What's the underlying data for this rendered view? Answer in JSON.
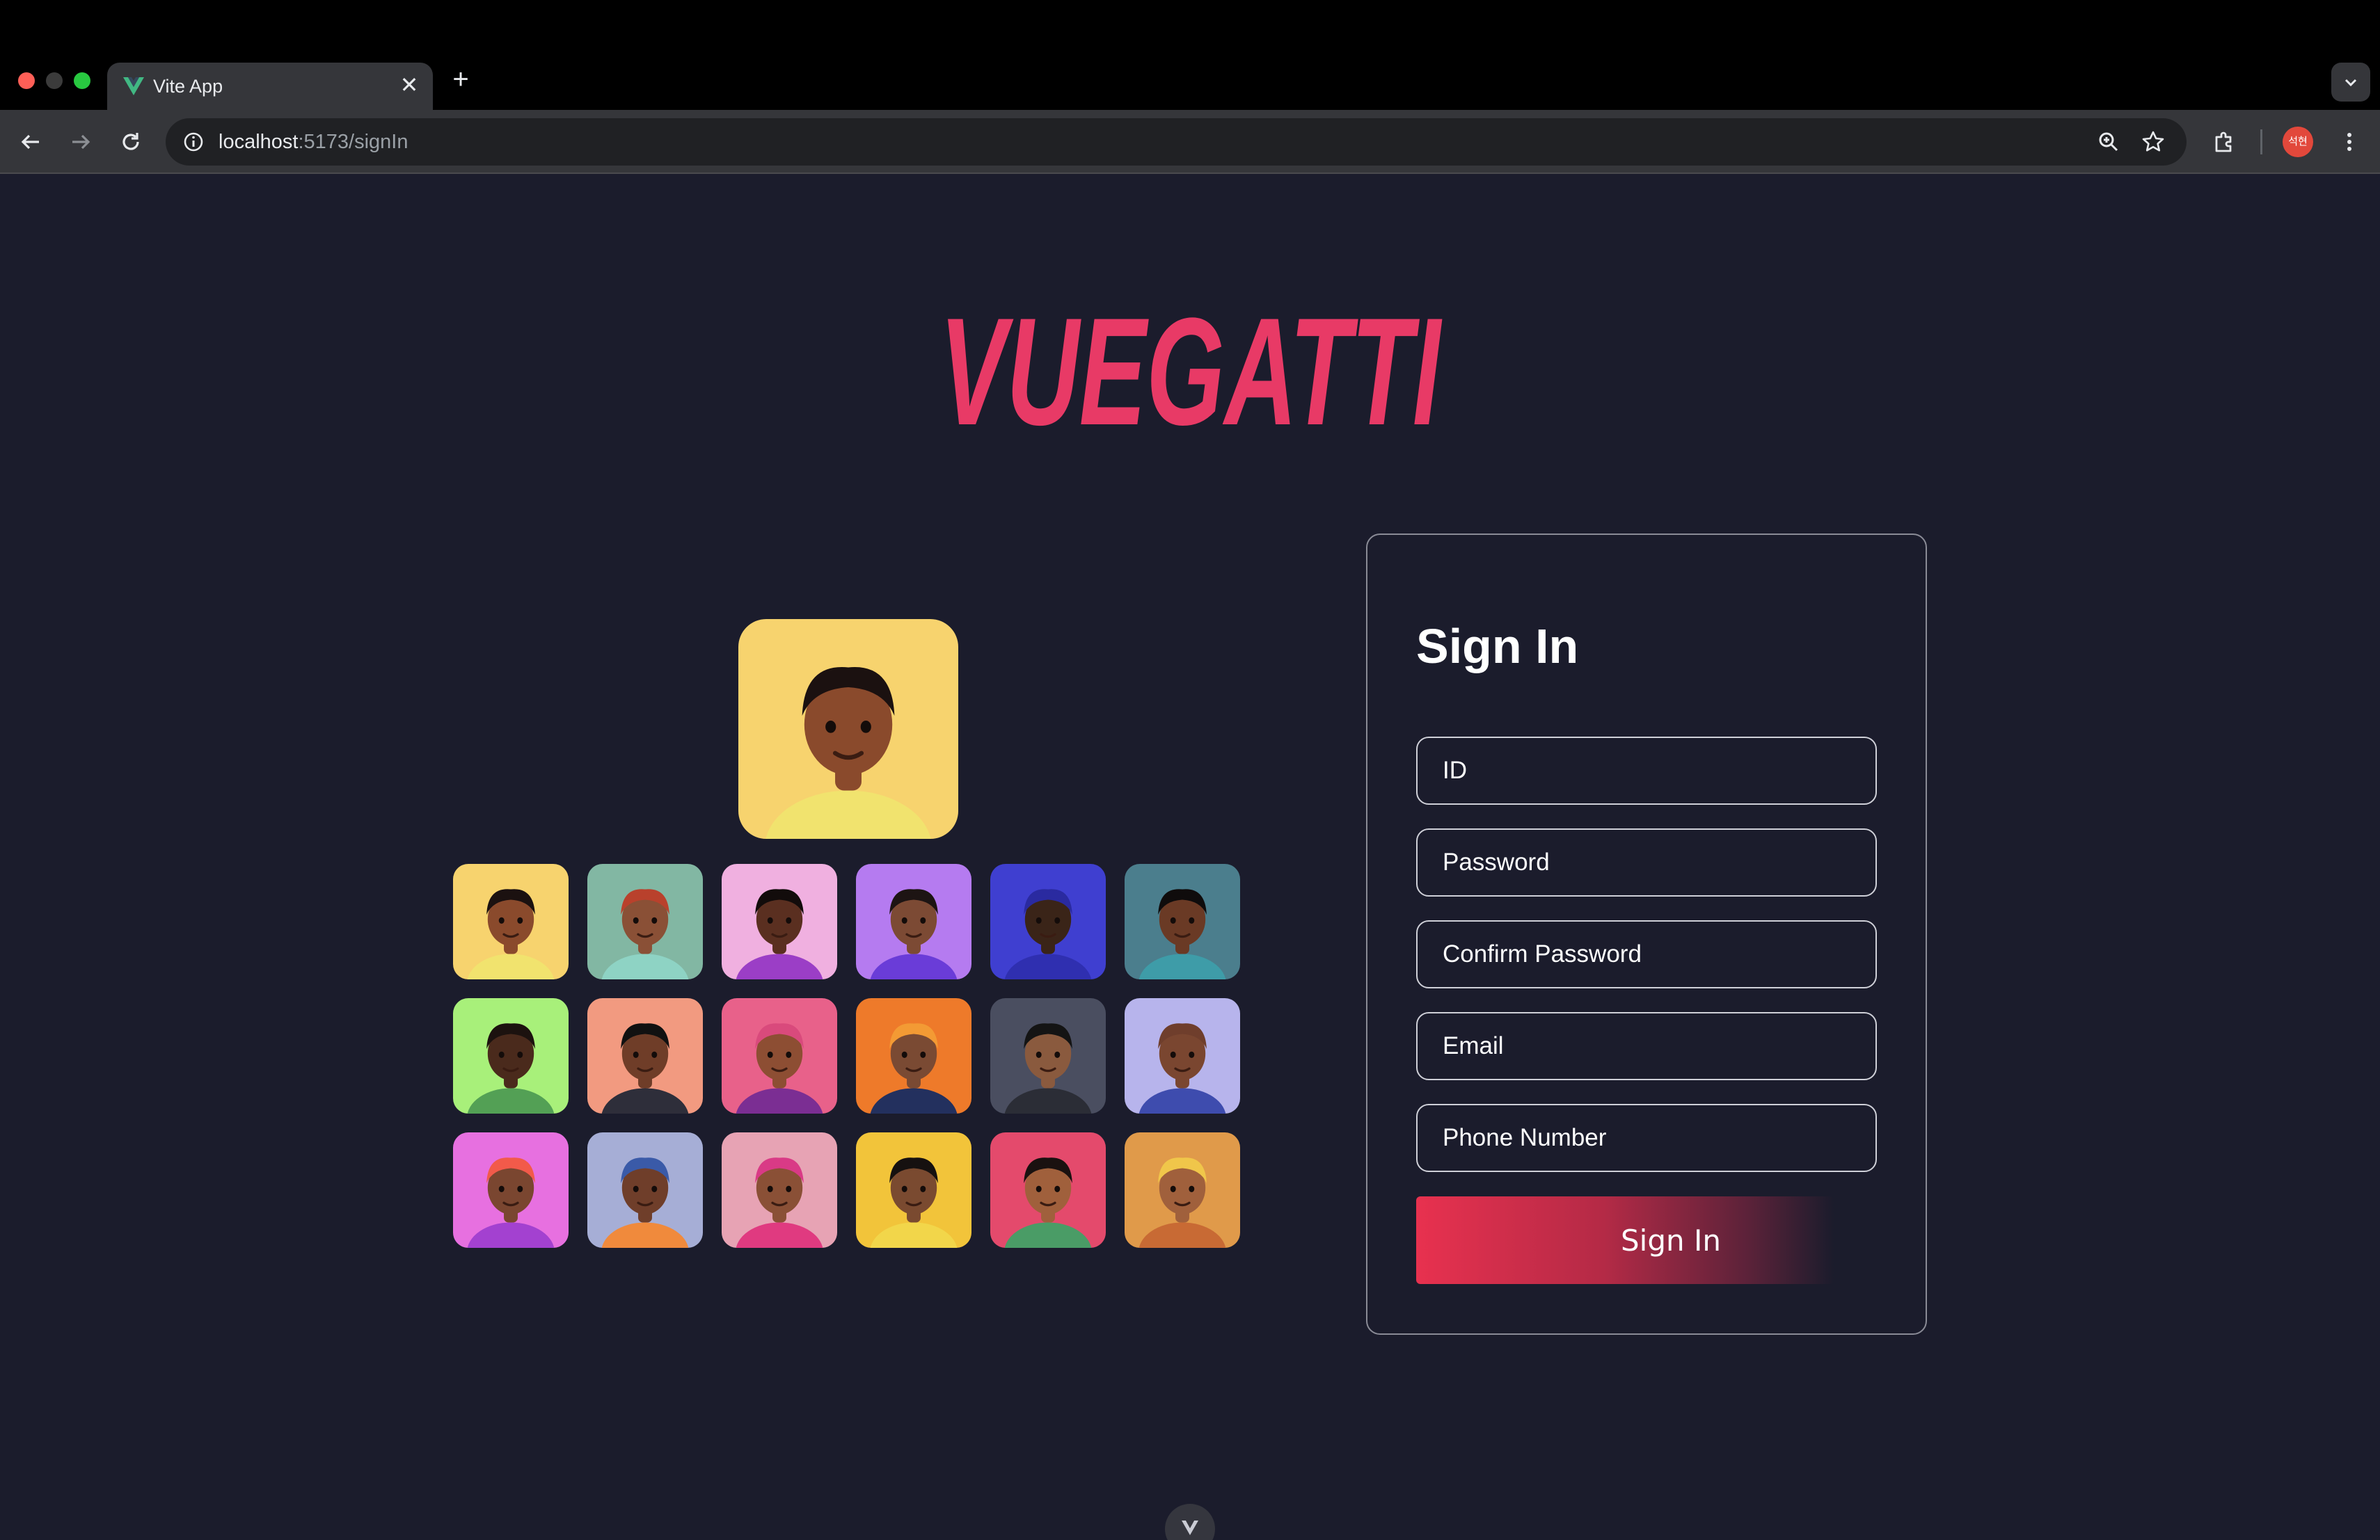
{
  "browser": {
    "tab_title": "Vite App",
    "tab_close": "✕",
    "new_tab": "+",
    "url_host": "localhost",
    "url_path": ":5173/signIn",
    "profile_initials": "석현"
  },
  "page": {
    "logo_text": "VUEGATTI",
    "brand_color": "#e83a66",
    "background": "#1b1c2c"
  },
  "avatars": {
    "featured": {
      "bg": "#f7d36e",
      "skin": "#8a4a2c",
      "hair": "#1b1110",
      "shirt": "#f1e36e"
    },
    "grid": [
      {
        "bg": "#f7d36e",
        "skin": "#8a4a2c",
        "hair": "#1b1110",
        "shirt": "#f1e36e"
      },
      {
        "bg": "#82b7a3",
        "skin": "#8a5036",
        "hair": "#b9412c",
        "shirt": "#8ed3c4"
      },
      {
        "bg": "#f0b0e0",
        "skin": "#5a2f20",
        "hair": "#120c0b",
        "shirt": "#9b3ec6"
      },
      {
        "bg": "#b57bf0",
        "skin": "#7c4a34",
        "hair": "#1d1413",
        "shirt": "#6a3cd8"
      },
      {
        "bg": "#3f3fd0",
        "skin": "#3a2418",
        "hair": "#2a2aa0",
        "shirt": "#2f2fb0"
      },
      {
        "bg": "#4b7e8d",
        "skin": "#6a3a25",
        "hair": "#0f0c0c",
        "shirt": "#3e9ca8"
      },
      {
        "bg": "#a8f07a",
        "skin": "#4a2a1c",
        "hair": "#1c120f",
        "shirt": "#53a055"
      },
      {
        "bg": "#f29a80",
        "skin": "#6f3d28",
        "hair": "#111",
        "shirt": "#2e2e3a"
      },
      {
        "bg": "#e8618a",
        "skin": "#8d4e33",
        "hair": "#d94a7c",
        "shirt": "#7b2e93"
      },
      {
        "bg": "#ee7a2a",
        "skin": "#7a4a33",
        "hair": "#f39a34",
        "shirt": "#23305e"
      },
      {
        "bg": "#4a4e60",
        "skin": "#8a5a3e",
        "hair": "#141414",
        "shirt": "#2b2d36"
      },
      {
        "bg": "#b7b4ec",
        "skin": "#7a4630",
        "hair": "#6f3e2c",
        "shirt": "#3e4cae"
      },
      {
        "bg": "#e770e0",
        "skin": "#7a4630",
        "hair": "#f25a4a",
        "shirt": "#a341d0"
      },
      {
        "bg": "#a6aed6",
        "skin": "#6f3e2a",
        "hair": "#3a5aa8",
        "shirt": "#f08a3c"
      },
      {
        "bg": "#e7a3b4",
        "skin": "#8a5036",
        "hair": "#d93a86",
        "shirt": "#e03a80"
      },
      {
        "bg": "#f2c43a",
        "skin": "#7a4a30",
        "hair": "#161110",
        "shirt": "#f2d64a"
      },
      {
        "bg": "#e44a6c",
        "skin": "#a0603c",
        "hair": "#1a1110",
        "shirt": "#4a9c66"
      },
      {
        "bg": "#e09a4a",
        "skin": "#a0603c",
        "hair": "#f0c64a",
        "shirt": "#c86a34"
      }
    ]
  },
  "form": {
    "title": "Sign In",
    "id_placeholder": "ID",
    "password_placeholder": "Password",
    "confirm_password_placeholder": "Confirm Password",
    "email_placeholder": "Email",
    "phone_placeholder": "Phone Number",
    "submit_label": "Sign In"
  }
}
